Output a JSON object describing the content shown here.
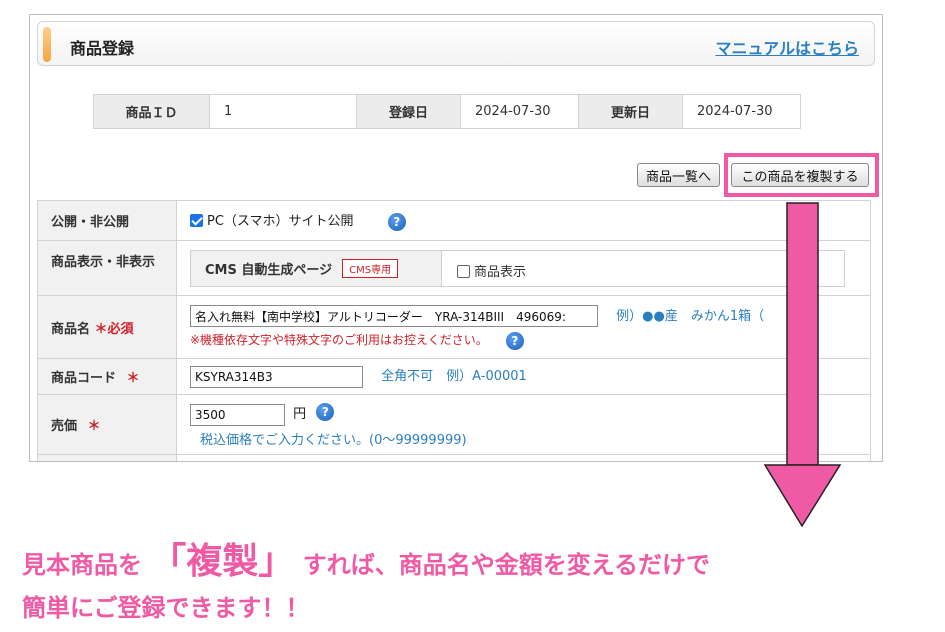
{
  "header": {
    "title": "商品登録",
    "manual_link": "マニュアルはこちら"
  },
  "id_table": {
    "id_label": "商品ＩＤ",
    "id_value": "1",
    "reg_label": "登録日",
    "reg_value": "2024-07-30",
    "upd_label": "更新日",
    "upd_value": "2024-07-30"
  },
  "buttons": {
    "list": "商品一覧へ",
    "duplicate": "この商品を複製する"
  },
  "rows": {
    "publish": {
      "label": "公開・非公開",
      "checkbox_label": "PC（スマホ）サイト公開",
      "help": "?"
    },
    "display": {
      "label": "商品表示・非表示",
      "cms_label": "CMS 自動生成ページ",
      "cms_badge": "CMS専用",
      "show_label": "商品表示"
    },
    "name": {
      "label": "商品名",
      "required": "＊必須",
      "value": "名入れ無料【南中学校】アルトリコーダー　YRA-314BIII　496069:",
      "example": "例）●●産　みかん1箱（",
      "note": "※機種依存文字や特殊文字のご利用はお控えください。",
      "help": "?"
    },
    "code": {
      "label": "商品コード",
      "required": "＊",
      "value": "KSYRA314B3",
      "hint": "全角不可　例）A-00001"
    },
    "price": {
      "label": "売価",
      "required": "＊",
      "value": "3500",
      "unit": "円",
      "hint": "税込価格でご入力ください。(0〜99999999)",
      "help": "?"
    }
  },
  "caption": {
    "line1_pre": "見本商品を",
    "line1_big": "「複製」",
    "line1_post": "すれば、商品名や金額を変えるだけで",
    "line2": "簡単にご登録できます！！"
  },
  "colors": {
    "accent_pink": "#f05aa5",
    "link_blue": "#2a7fc0",
    "required_red": "#d0212a"
  }
}
